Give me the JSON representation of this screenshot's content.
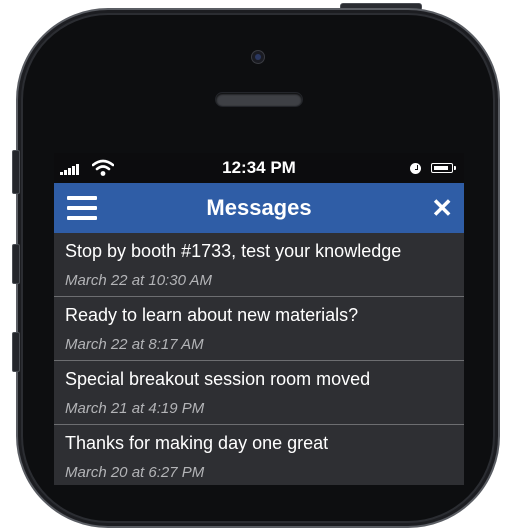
{
  "status_bar": {
    "time": "12:34 PM",
    "signal_icon": "cellular-signal-icon",
    "wifi_icon": "wifi-icon",
    "alarm_icon": "alarm-clock-icon",
    "battery_icon": "battery-icon"
  },
  "header": {
    "title": "Messages",
    "menu_icon": "hamburger-menu-icon",
    "close_icon": "close-icon",
    "accent_color": "#2f5da6"
  },
  "messages": [
    {
      "title": "Stop by booth #1733, test your knowledge",
      "date": "March 22 at 10:30 AM"
    },
    {
      "title": "Ready to learn about new materials?",
      "date": "March 22 at 8:17 AM"
    },
    {
      "title": "Special breakout session room moved",
      "date": "March 21 at 4:19 PM"
    },
    {
      "title": "Thanks for making day one great",
      "date": "March 20 at 6:27 PM"
    }
  ]
}
